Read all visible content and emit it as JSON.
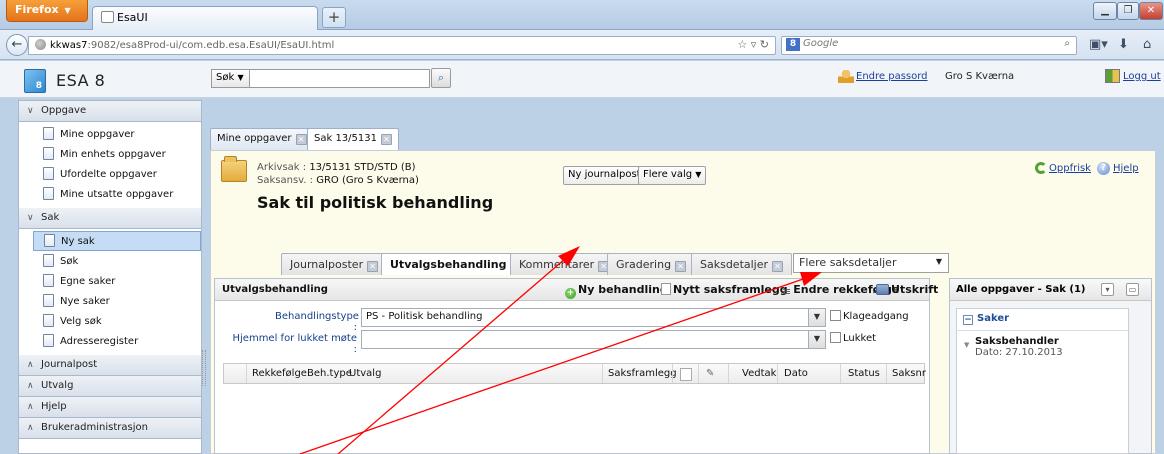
{
  "browser": {
    "app_button": "Firefox",
    "tab_title": "EsaUI",
    "url_host": "kkwas7",
    "url_path": ":9082/esa8Prod-ui/com.edb.esa.EsaUI/EsaUI.html",
    "search_engine": "Google"
  },
  "header": {
    "logo_badge": "8",
    "app_name": "ESA 8",
    "search_type": "Søk",
    "change_password": "Endre passord",
    "user_name": "Gro S Kværna",
    "logout": "Logg ut"
  },
  "sidebar": {
    "sections": [
      {
        "title": "Oppgave",
        "expanded": true,
        "items": [
          "Mine oppgaver",
          "Min enhets oppgaver",
          "Ufordelte oppgaver",
          "Mine utsatte oppgaver"
        ]
      },
      {
        "title": "Sak",
        "expanded": true,
        "items": [
          "Ny sak",
          "Søk",
          "Egne saker",
          "Nye saker",
          "Velg søk",
          "Adresseregister"
        ],
        "selected": "Ny sak"
      },
      {
        "title": "Journalpost",
        "expanded": false
      },
      {
        "title": "Utvalg",
        "expanded": false
      },
      {
        "title": "Hjelp",
        "expanded": false
      },
      {
        "title": "Brukeradministrasjon",
        "expanded": false
      }
    ]
  },
  "main_tabs": [
    "Mine oppgaver",
    "Sak 13/5131"
  ],
  "case": {
    "archive_label": "Arkivsak :",
    "archive_value": "13/5131 STD/STD (B)",
    "officer_label": "Saksansv. :",
    "officer_value": "GRO (Gro S Kværna)",
    "title": "Sak til politisk behandling",
    "new_journal_post": "Ny journalpost",
    "more_choices": "Flere valg",
    "refresh": "Oppfrisk",
    "help": "Hjelp"
  },
  "sub_tabs": [
    "Journalposter",
    "Utvalgsbehandling",
    "Kommentarer",
    "Gradering",
    "Saksdetaljer"
  ],
  "sub_tab_active": "Utvalgsbehandling",
  "sub_tab_more": "Flere saksdetaljer",
  "panel": {
    "title": "Utvalgsbehandling",
    "toolbar": {
      "new_treatment": "Ny behandling",
      "new_presentation": "Nytt saksframlegg",
      "change_order": "Endre rekkefølge",
      "print": "Utskrift"
    },
    "form": {
      "treatment_type_label": "Behandlingstype :",
      "treatment_type_value": "PS - Politisk behandling",
      "appeal_access": "Klageadgang",
      "closed_meeting_label": "Hjemmel for lukket møte :",
      "closed_meeting_value": "",
      "closed": "Lukket"
    },
    "columns": [
      "Rekkefølge",
      "Beh.type",
      "Utvalg",
      "Saksframlegg",
      "Vedtak",
      "Dato",
      "Status",
      "Saksnr"
    ]
  },
  "right_panel": {
    "title": "Alle oppgaver - Sak (1)",
    "group": "Saker",
    "item_title": "Saksbehandler",
    "item_date": "Dato: 27.10.2013"
  },
  "colors": {
    "annotation_arrow": "#ff0000",
    "link": "#1a3f9c",
    "selected_row": "#c6dcf5"
  }
}
